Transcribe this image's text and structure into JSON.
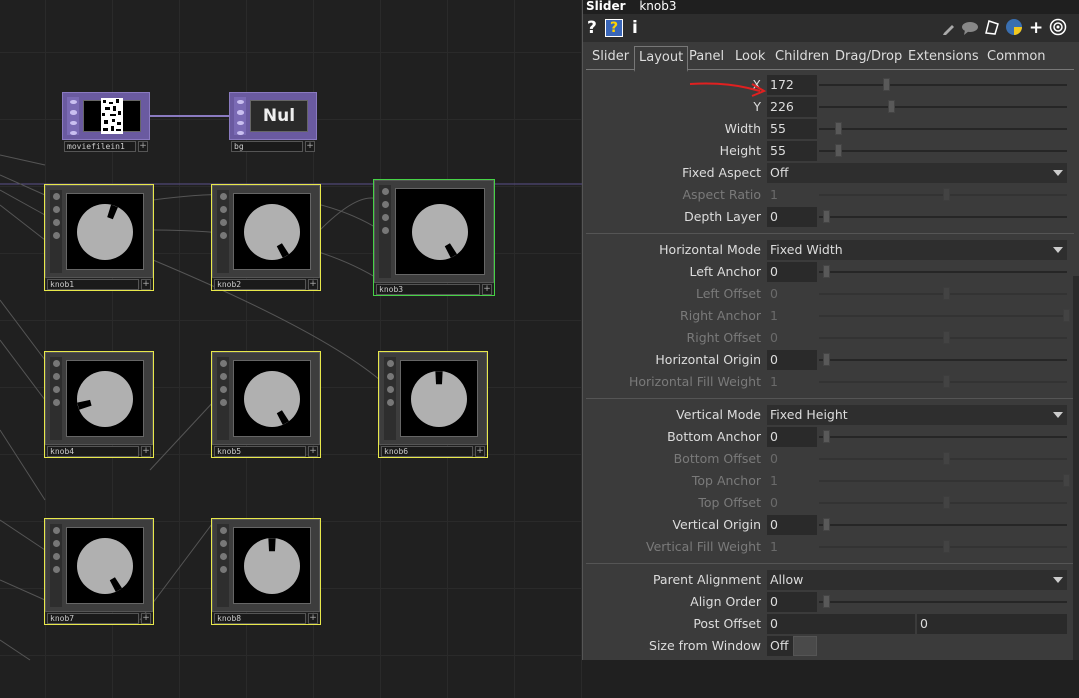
{
  "network": {
    "nodes": {
      "moviefilein": {
        "label": "moviefilein1",
        "thumb_icon": "noise-image"
      },
      "bg": {
        "label": "bg",
        "preview": "Nul"
      },
      "knobs": [
        {
          "label": "knob1",
          "notch_deg": 20
        },
        {
          "label": "knob2",
          "notch_deg": 150
        },
        {
          "label": "knob3",
          "notch_deg": 150
        },
        {
          "label": "knob4",
          "notch_deg": 255
        },
        {
          "label": "knob5",
          "notch_deg": 150
        },
        {
          "label": "knob6",
          "notch_deg": 0
        },
        {
          "label": "knob7",
          "notch_deg": 150
        },
        {
          "label": "knob8",
          "notch_deg": 0
        }
      ],
      "selected": "knob3",
      "plus": "+"
    }
  },
  "panel": {
    "op_type": "Slider",
    "op_name": "knob3",
    "toolbar": {
      "help": "?",
      "help_py": "?",
      "info": "i",
      "plus": "+"
    },
    "tabs": [
      "Slider",
      "Layout",
      "Panel",
      "Look",
      "Children",
      "Drag/Drop",
      "Extensions",
      "Common"
    ],
    "active_tab": "Layout",
    "params": {
      "x": {
        "label": "X",
        "value": "172"
      },
      "y": {
        "label": "Y",
        "value": "226"
      },
      "width": {
        "label": "Width",
        "value": "55"
      },
      "height": {
        "label": "Height",
        "value": "55"
      },
      "fixed_aspect": {
        "label": "Fixed Aspect",
        "value": "Off"
      },
      "aspect_ratio": {
        "label": "Aspect Ratio",
        "value": "1"
      },
      "depth_layer": {
        "label": "Depth Layer",
        "value": "0"
      },
      "horizontal_mode": {
        "label": "Horizontal Mode",
        "value": "Fixed Width"
      },
      "left_anchor": {
        "label": "Left Anchor",
        "value": "0"
      },
      "left_offset": {
        "label": "Left Offset",
        "value": "0"
      },
      "right_anchor": {
        "label": "Right Anchor",
        "value": "1"
      },
      "right_offset": {
        "label": "Right Offset",
        "value": "0"
      },
      "horizontal_origin": {
        "label": "Horizontal Origin",
        "value": "0"
      },
      "horizontal_fill_weight": {
        "label": "Horizontal Fill Weight",
        "value": "1"
      },
      "vertical_mode": {
        "label": "Vertical Mode",
        "value": "Fixed Height"
      },
      "bottom_anchor": {
        "label": "Bottom Anchor",
        "value": "0"
      },
      "bottom_offset": {
        "label": "Bottom Offset",
        "value": "0"
      },
      "top_anchor": {
        "label": "Top Anchor",
        "value": "1"
      },
      "top_offset": {
        "label": "Top Offset",
        "value": "0"
      },
      "vertical_origin": {
        "label": "Vertical Origin",
        "value": "0"
      },
      "vertical_fill_weight": {
        "label": "Vertical Fill Weight",
        "value": "1"
      },
      "parent_alignment": {
        "label": "Parent Alignment",
        "value": "Allow"
      },
      "align_order": {
        "label": "Align Order",
        "value": "0"
      },
      "post_offset": {
        "label": "Post Offset",
        "value1": "0",
        "value2": "0"
      },
      "size_from_window": {
        "label": "Size from Window",
        "value": "Off"
      }
    }
  },
  "colors": {
    "selected_outline": "#46d246",
    "node_outline": "#e8e84a",
    "annotation_arrow": "#e02020",
    "wire": "#8a7ac0"
  }
}
